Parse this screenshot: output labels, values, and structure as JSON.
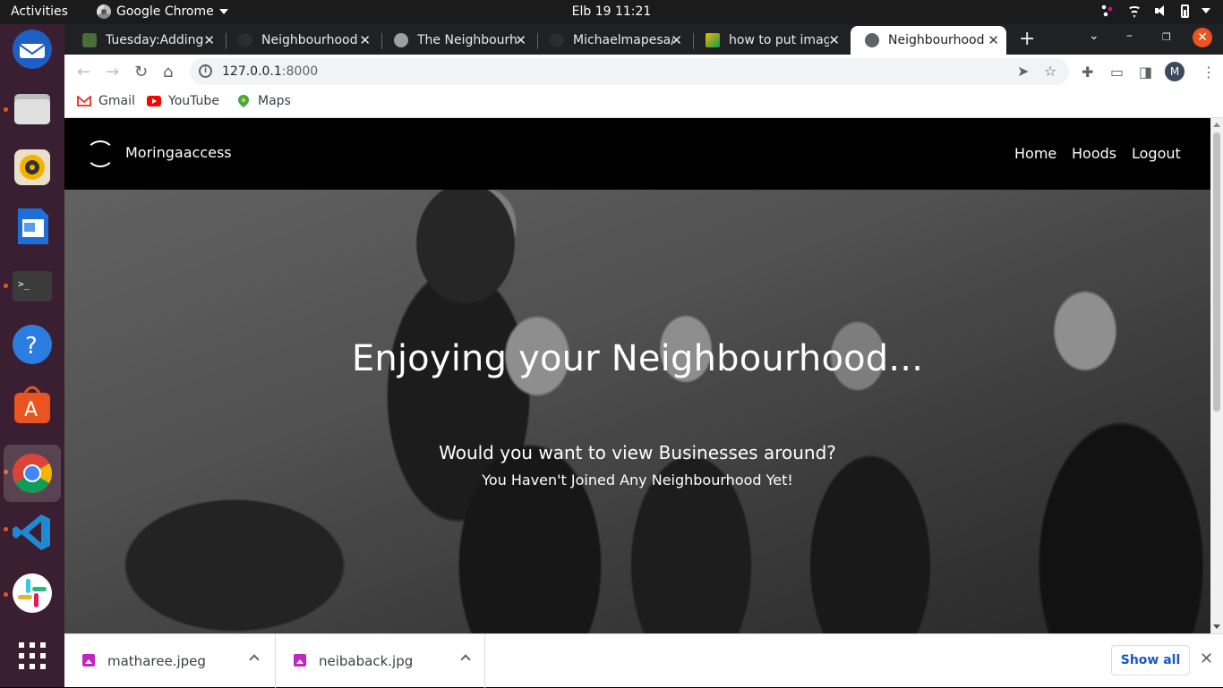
{
  "system": {
    "activities": "Activities",
    "app_name": "Google Chrome",
    "clock": "Elb 19  11:21"
  },
  "tabs": [
    {
      "label": "Tuesday:Adding",
      "active": false
    },
    {
      "label": "Neighbourhood",
      "active": false
    },
    {
      "label": "The Neighbourh",
      "active": false
    },
    {
      "label": "Michaelmapesa/",
      "active": false
    },
    {
      "label": "how to put imag",
      "active": false
    },
    {
      "label": "Neighbourhood",
      "active": true
    }
  ],
  "omnibar": {
    "url_host": "127.0.0.1",
    "url_port": ":8000",
    "avatar_letter": "M"
  },
  "bookmarks": [
    {
      "label": "Gmail",
      "color": "#ea4335"
    },
    {
      "label": "YouTube",
      "color": "#ff0000"
    },
    {
      "label": "Maps",
      "color": "#34a853"
    }
  ],
  "site": {
    "brand": "Moringaaccess",
    "nav": [
      "Home",
      "Hoods",
      "Logout"
    ],
    "hero_title": "Enjoying your Neighbourhood...",
    "hero_subtitle": "Would you want to view Businesses around?",
    "hero_note": "You Haven't Joined Any Neighbourhood Yet!"
  },
  "downloads": {
    "items": [
      "matharee.jpeg",
      "neibaback.jpg"
    ],
    "show_all": "Show all"
  },
  "colors": {
    "dock_bg": "#3a1f33",
    "accent_orange": "#e95420",
    "link_blue": "#1a56c4"
  }
}
